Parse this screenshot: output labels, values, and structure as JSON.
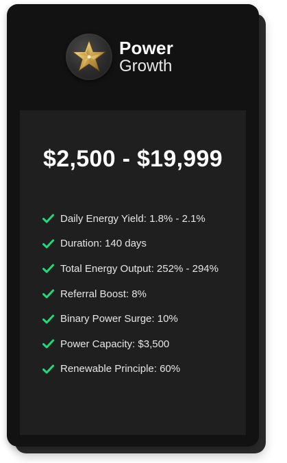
{
  "plan": {
    "brand_line1": "Power",
    "brand_line2": "Growth",
    "logo_icon": "gold-star-icon",
    "price_range": "$2,500 - $19,999",
    "features": [
      "Daily Energy Yield: 1.8% - 2.1%",
      "Duration: 140 days",
      "Total Energy Output: 252% - 294%",
      "Referral Boost: 8%",
      "Binary Power Surge: 10%",
      "Power Capacity: $3,500",
      "Renewable Principle: 60%"
    ],
    "check_icon": "check-icon"
  },
  "colors": {
    "card_background": "#121212",
    "panel_background": "#1f1f1f",
    "check_green": "#1fdc7a",
    "star_gold": "#d8b25a"
  }
}
